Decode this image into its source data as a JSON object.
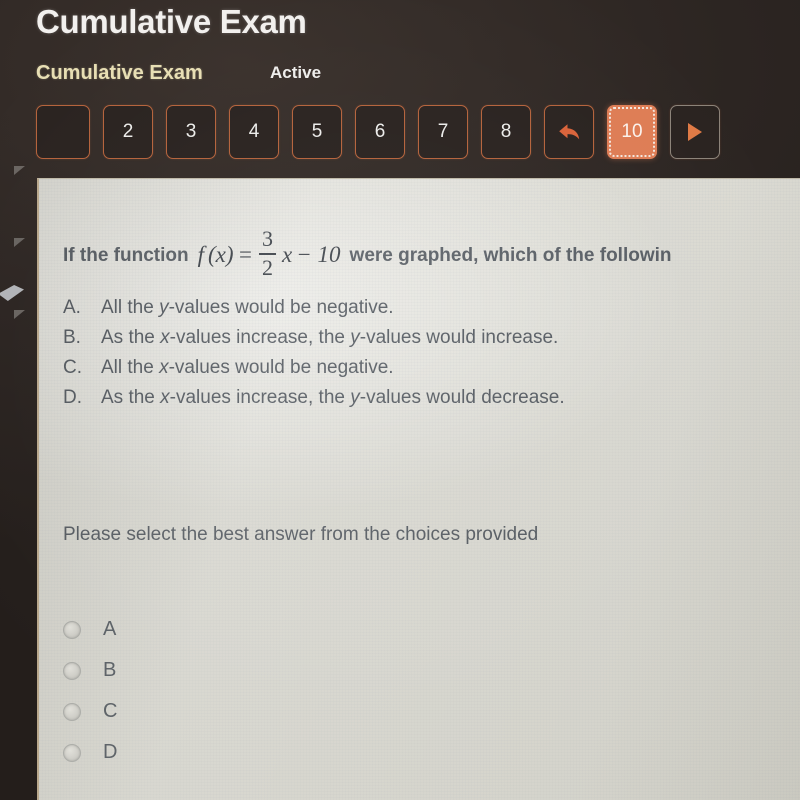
{
  "header": {
    "title": "Cumulative Exam",
    "breadcrumb": "Cumulative Exam",
    "status": "Active"
  },
  "question_nav": {
    "buttons": [
      {
        "label": "",
        "name": "question-1-button",
        "state": "normal"
      },
      {
        "label": "2",
        "name": "question-2-button",
        "state": "normal"
      },
      {
        "label": "3",
        "name": "question-3-button",
        "state": "normal"
      },
      {
        "label": "4",
        "name": "question-4-button",
        "state": "normal"
      },
      {
        "label": "5",
        "name": "question-5-button",
        "state": "normal"
      },
      {
        "label": "6",
        "name": "question-6-button",
        "state": "normal"
      },
      {
        "label": "7",
        "name": "question-7-button",
        "state": "normal"
      },
      {
        "label": "8",
        "name": "question-8-button",
        "state": "normal"
      }
    ],
    "back_icon": "reply-back-arrow-icon",
    "current": {
      "label": "10",
      "name": "question-10-button"
    },
    "forward_icon": "play-forward-triangle-icon"
  },
  "question": {
    "stem_before": "If the function",
    "formula": {
      "function_name": "f",
      "variable": "(x)",
      "equals": "=",
      "numerator": "3",
      "denominator": "2",
      "term": "x",
      "constant": "− 10"
    },
    "stem_after": "were graphed, which of the followin",
    "choices": [
      {
        "letter": "A.",
        "text": "All the y-values would be negative."
      },
      {
        "letter": "B.",
        "text": "As the x-values increase, the y-values would increase."
      },
      {
        "letter": "C.",
        "text": "All the x-values would be negative."
      },
      {
        "letter": "D.",
        "text": "As the x-values increase, the y-values would decrease."
      }
    ],
    "instruction": "Please select the best answer from the choices provided"
  },
  "answer_options": [
    {
      "label": "A",
      "selected": false
    },
    {
      "label": "B",
      "selected": false
    },
    {
      "label": "C",
      "selected": false
    },
    {
      "label": "D",
      "selected": false
    }
  ],
  "colors": {
    "accent_orange": "#de7d55",
    "nav_border": "#b5633c",
    "breadcrumb_yellow": "#e8dfb4",
    "paper": "#d9d8d0",
    "text_grey": "#4b5158",
    "chrome_dark": "#2b2421"
  }
}
